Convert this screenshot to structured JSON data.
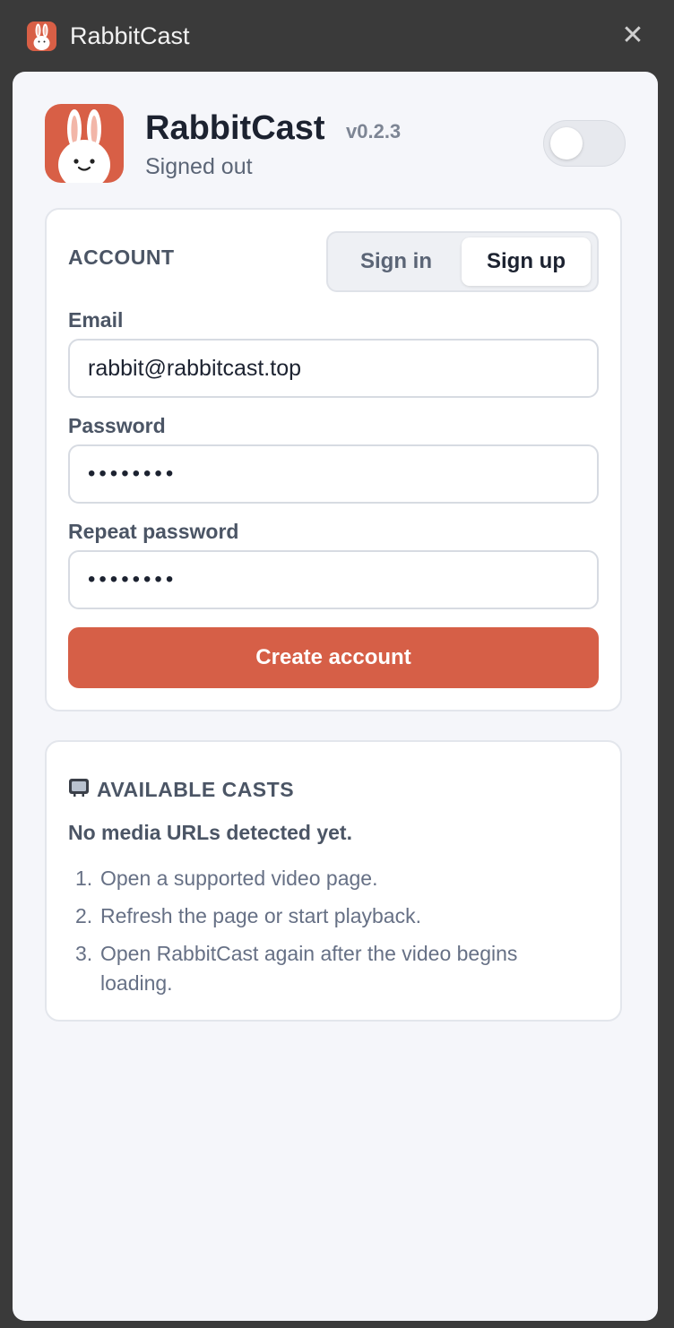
{
  "window": {
    "title": "RabbitCast",
    "close_glyph": "✕"
  },
  "header": {
    "app_name": "RabbitCast",
    "version": "v0.2.3",
    "status": "Signed out",
    "toggle_on": false
  },
  "account": {
    "heading": "ACCOUNT",
    "tabs": [
      {
        "label": "Sign in",
        "active": false
      },
      {
        "label": "Sign up",
        "active": true
      }
    ],
    "email_label": "Email",
    "email_value": "rabbit@rabbitcast.top",
    "password_label": "Password",
    "password_value": "••••••••",
    "repeat_label": "Repeat password",
    "repeat_value": "••••••••",
    "submit_label": "Create account"
  },
  "casts": {
    "heading": "AVAILABLE CASTS",
    "heading_icon": "tv-icon",
    "empty_title": "No media URLs detected yet.",
    "steps": [
      {
        "num": "1.",
        "text": "Open a supported video page."
      },
      {
        "num": "2.",
        "text": "Refresh the page or start playback."
      },
      {
        "num": "3.",
        "text": "Open RabbitCast again after the video begins loading."
      }
    ]
  },
  "colors": {
    "brand": "#d85f46",
    "panel_bg": "#f5f6fa",
    "window_bg": "#3a3a3a"
  }
}
